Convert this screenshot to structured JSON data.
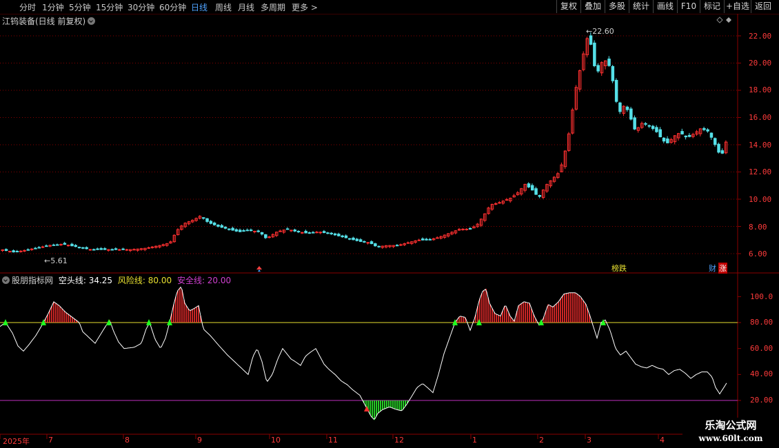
{
  "toolbar": {
    "periods": [
      "分时",
      "1分钟",
      "5分钟",
      "15分钟",
      "30分钟",
      "60分钟",
      "日线",
      "周线",
      "月线",
      "多周期",
      "更多 >"
    ],
    "buttons": [
      "复权",
      "叠加",
      "多股",
      "统计",
      "画线",
      "F10",
      "标记",
      "+自选",
      "返回"
    ]
  },
  "main_chart": {
    "title": "江钨装备(日线 前复权)",
    "high_label": "22.60",
    "low_label": "5.61",
    "yticks": [
      "22.00",
      "20.00",
      "18.00",
      "16.00",
      "14.00",
      "12.00",
      "10.00",
      "8.00",
      "6.00"
    ],
    "badges": {
      "rank": "榜跌",
      "finance": "财",
      "rise": "涨"
    }
  },
  "indicator": {
    "name": "股朋指标网",
    "kong_label": "空头线: 34.25",
    "risk_label": "风险线: 80.00",
    "safe_label": "安全线: 20.00",
    "yticks": [
      "100.0",
      "80.00",
      "60.00",
      "40.00",
      "20.00"
    ],
    "risk_value": 80,
    "safe_value": 20,
    "current_value": 34.25
  },
  "x_axis": {
    "labels": [
      "2025年",
      "7",
      "8",
      "9",
      "10",
      "11",
      "12",
      "1",
      "2",
      "3",
      "4"
    ]
  },
  "watermark": {
    "line1": "乐淘公式网",
    "line2": "www.60lt.com"
  },
  "colors": {
    "up": "#ff3030",
    "down": "#55e0e8",
    "risk": "#e8e030",
    "safe": "#c030c0",
    "grid": "#8b0000",
    "accent": "#4fa3ff"
  },
  "chart_data": [
    {
      "type": "candlestick",
      "title": "江钨装备(日线 前复权)",
      "ylim": [
        5.0,
        23.0
      ],
      "anchors_close": [
        [
          0,
          6.3
        ],
        [
          20,
          6.1
        ],
        [
          40,
          6.3
        ],
        [
          60,
          6.5
        ],
        [
          70,
          6.6
        ],
        [
          90,
          6.7
        ],
        [
          110,
          6.5
        ],
        [
          130,
          6.3
        ],
        [
          150,
          6.3
        ],
        [
          170,
          6.3
        ],
        [
          190,
          6.3
        ],
        [
          210,
          6.4
        ],
        [
          230,
          6.6
        ],
        [
          245,
          6.8
        ],
        [
          255,
          7.7
        ],
        [
          265,
          8.2
        ],
        [
          280,
          8.5
        ],
        [
          290,
          8.8
        ],
        [
          300,
          8.3
        ],
        [
          315,
          8.0
        ],
        [
          330,
          7.8
        ],
        [
          345,
          7.6
        ],
        [
          360,
          7.7
        ],
        [
          375,
          7.6
        ],
        [
          385,
          7.1
        ],
        [
          400,
          7.6
        ],
        [
          415,
          7.8
        ],
        [
          430,
          7.6
        ],
        [
          445,
          7.5
        ],
        [
          460,
          7.6
        ],
        [
          475,
          7.5
        ],
        [
          490,
          7.3
        ],
        [
          505,
          7.1
        ],
        [
          520,
          6.9
        ],
        [
          535,
          6.8
        ],
        [
          545,
          6.5
        ],
        [
          560,
          6.6
        ],
        [
          575,
          6.6
        ],
        [
          590,
          6.8
        ],
        [
          605,
          7.0
        ],
        [
          620,
          7.0
        ],
        [
          635,
          7.2
        ],
        [
          650,
          7.5
        ],
        [
          665,
          7.8
        ],
        [
          680,
          7.8
        ],
        [
          690,
          8.1
        ],
        [
          700,
          8.8
        ],
        [
          710,
          9.6
        ],
        [
          720,
          9.7
        ],
        [
          730,
          9.9
        ],
        [
          740,
          10.1
        ],
        [
          750,
          10.5
        ],
        [
          760,
          11.1
        ],
        [
          770,
          10.7
        ],
        [
          780,
          10.1
        ],
        [
          790,
          11.0
        ],
        [
          800,
          11.5
        ],
        [
          810,
          12.0
        ],
        [
          815,
          12.9
        ],
        [
          822,
          14.3
        ],
        [
          828,
          16.3
        ],
        [
          835,
          18.5
        ],
        [
          842,
          20.0
        ],
        [
          848,
          21.5
        ],
        [
          852,
          22.1
        ],
        [
          857,
          21.0
        ],
        [
          863,
          19.0
        ],
        [
          870,
          20.0
        ],
        [
          876,
          20.2
        ],
        [
          882,
          19.8
        ],
        [
          888,
          18.5
        ],
        [
          893,
          17.0
        ],
        [
          898,
          16.4
        ],
        [
          905,
          17.0
        ],
        [
          912,
          16.1
        ],
        [
          920,
          15.0
        ],
        [
          930,
          15.6
        ],
        [
          940,
          15.4
        ],
        [
          950,
          15.0
        ],
        [
          960,
          14.3
        ],
        [
          968,
          14.1
        ],
        [
          975,
          14.6
        ],
        [
          985,
          14.9
        ],
        [
          995,
          14.5
        ],
        [
          1005,
          14.8
        ],
        [
          1015,
          15.2
        ],
        [
          1025,
          15.0
        ],
        [
          1033,
          14.3
        ],
        [
          1040,
          13.5
        ],
        [
          1045,
          13.2
        ],
        [
          1050,
          14.0
        ],
        [
          1055,
          14.7
        ]
      ]
    },
    {
      "type": "line",
      "series": [
        {
          "name": "空头线",
          "anchors": [
            [
              0,
              77
            ],
            [
              8,
              80
            ],
            [
              18,
              72
            ],
            [
              26,
              62
            ],
            [
              34,
              58
            ],
            [
              42,
              63
            ],
            [
              52,
              70
            ],
            [
              62,
              79
            ],
            [
              70,
              87
            ],
            [
              78,
              96
            ],
            [
              86,
              93
            ],
            [
              95,
              88
            ],
            [
              105,
              84
            ],
            [
              115,
              80
            ],
            [
              120,
              73
            ],
            [
              130,
              68
            ],
            [
              138,
              64
            ],
            [
              146,
              71
            ],
            [
              153,
              77
            ],
            [
              159,
              82
            ],
            [
              165,
              73
            ],
            [
              172,
              65
            ],
            [
              180,
              60
            ],
            [
              195,
              61
            ],
            [
              205,
              64
            ],
            [
              212,
              75
            ],
            [
              217,
              80
            ],
            [
              225,
              67
            ],
            [
              233,
              60
            ],
            [
              240,
              68
            ],
            [
              246,
              80
            ],
            [
              252,
              94
            ],
            [
              257,
              104
            ],
            [
              263,
              108
            ],
            [
              268,
              95
            ],
            [
              275,
              89
            ],
            [
              282,
              91
            ],
            [
              288,
              93
            ],
            [
              295,
              75
            ],
            [
              305,
              70
            ],
            [
              318,
              62
            ],
            [
              330,
              55
            ],
            [
              340,
              50
            ],
            [
              352,
              44
            ],
            [
              360,
              40
            ],
            [
              367,
              54
            ],
            [
              373,
              60
            ],
            [
              380,
              50
            ],
            [
              387,
              34
            ],
            [
              395,
              40
            ],
            [
              403,
              52
            ],
            [
              410,
              60
            ],
            [
              416,
              56
            ],
            [
              422,
              52
            ],
            [
              428,
              50
            ],
            [
              436,
              47
            ],
            [
              443,
              54
            ],
            [
              450,
              57
            ],
            [
              458,
              60
            ],
            [
              464,
              54
            ],
            [
              470,
              48
            ],
            [
              477,
              44
            ],
            [
              486,
              40
            ],
            [
              495,
              35
            ],
            [
              504,
              32
            ],
            [
              512,
              28
            ],
            [
              522,
              24
            ],
            [
              532,
              14
            ],
            [
              538,
              8
            ],
            [
              543,
              5
            ],
            [
              548,
              10
            ],
            [
              555,
              13
            ],
            [
              565,
              15
            ],
            [
              575,
              13
            ],
            [
              583,
              12
            ],
            [
              590,
              17
            ],
            [
              597,
              23
            ],
            [
              605,
              30
            ],
            [
              613,
              33
            ],
            [
              620,
              30
            ],
            [
              628,
              26
            ],
            [
              636,
              40
            ],
            [
              644,
              56
            ],
            [
              652,
              68
            ],
            [
              660,
              80
            ],
            [
              667,
              85
            ],
            [
              675,
              84
            ],
            [
              682,
              74
            ],
            [
              689,
              84
            ],
            [
              695,
              97
            ],
            [
              700,
              104
            ],
            [
              705,
              106
            ],
            [
              710,
              95
            ],
            [
              718,
              87
            ],
            [
              726,
              85
            ],
            [
              733,
              94
            ],
            [
              740,
              85
            ],
            [
              746,
              81
            ],
            [
              752,
              93
            ],
            [
              760,
              96
            ],
            [
              768,
              95
            ],
            [
              775,
              85
            ],
            [
              782,
              78
            ],
            [
              788,
              83
            ],
            [
              795,
              94
            ],
            [
              802,
              92
            ],
            [
              810,
              96
            ],
            [
              818,
              102
            ],
            [
              826,
              103
            ],
            [
              835,
              103
            ],
            [
              842,
              100
            ],
            [
              850,
              94
            ],
            [
              856,
              85
            ],
            [
              860,
              78
            ],
            [
              866,
              68
            ],
            [
              872,
              80
            ],
            [
              878,
              82
            ],
            [
              885,
              74
            ],
            [
              893,
              60
            ],
            [
              900,
              55
            ],
            [
              908,
              58
            ],
            [
              915,
              53
            ],
            [
              922,
              48
            ],
            [
              930,
              46
            ],
            [
              938,
              45
            ],
            [
              946,
              47
            ],
            [
              954,
              45
            ],
            [
              962,
              44
            ],
            [
              970,
              40
            ],
            [
              978,
              43
            ],
            [
              986,
              44
            ],
            [
              994,
              41
            ],
            [
              1002,
              37
            ],
            [
              1010,
              40
            ],
            [
              1018,
              42
            ],
            [
              1026,
              42
            ],
            [
              1033,
              38
            ],
            [
              1038,
              30
            ],
            [
              1044,
              25
            ],
            [
              1050,
              30
            ],
            [
              1055,
              34.25
            ]
          ]
        }
      ],
      "ylim": [
        0,
        116
      ],
      "risk_line": 80,
      "safe_line": 20,
      "buy_signals_x": [
        8,
        63,
        158,
        216,
        246,
        660,
        695,
        785,
        875
      ],
      "sell_signals_x": [
        532
      ]
    }
  ]
}
